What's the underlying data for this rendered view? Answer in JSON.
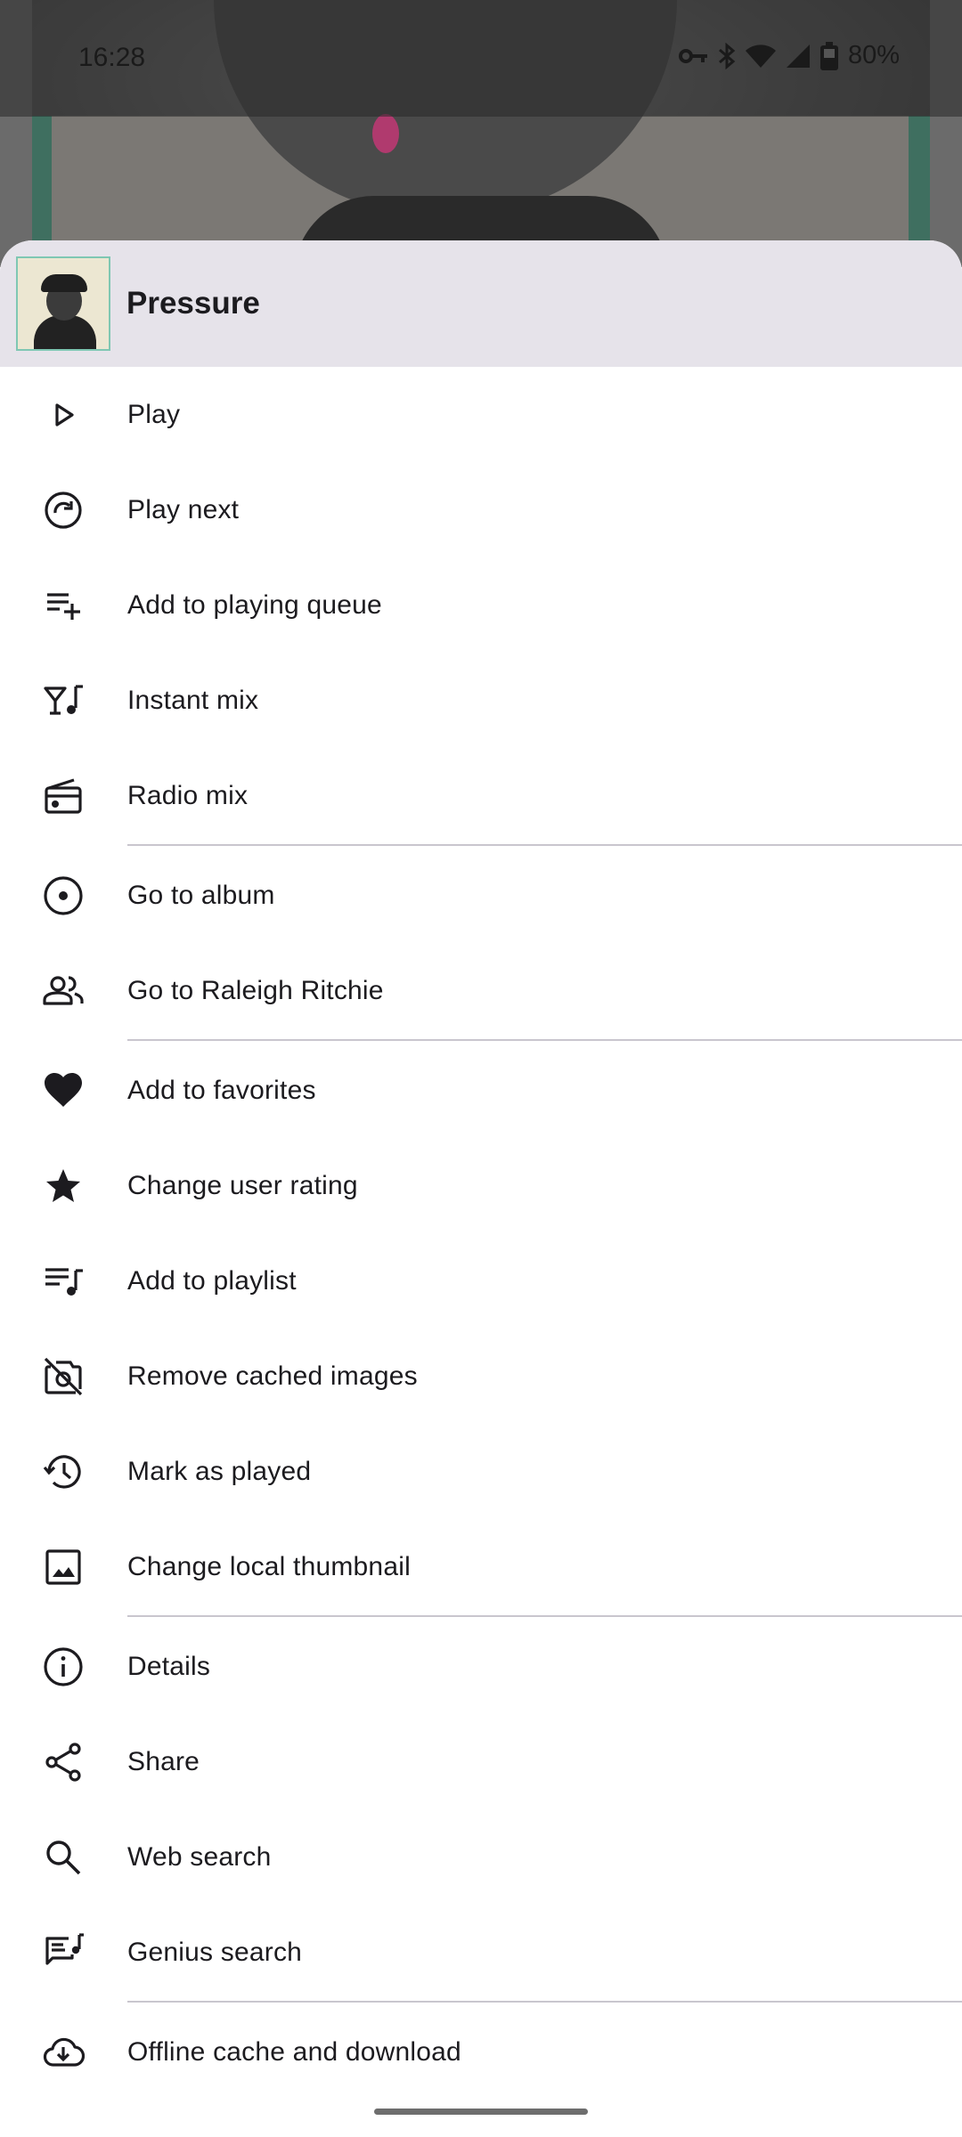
{
  "status_bar": {
    "time": "16:28",
    "battery": "80%"
  },
  "sheet": {
    "title": "Pressure",
    "menu": [
      {
        "label": "Play",
        "icon": "play-icon"
      },
      {
        "label": "Play next",
        "icon": "play-next-icon"
      },
      {
        "label": "Add to playing queue",
        "icon": "queue-add-icon"
      },
      {
        "label": "Instant mix",
        "icon": "instant-mix-icon"
      },
      {
        "label": "Radio mix",
        "icon": "radio-icon"
      },
      {
        "label": "Go to album",
        "icon": "album-icon"
      },
      {
        "label": "Go to Raleigh Ritchie",
        "icon": "artist-icon"
      },
      {
        "label": "Add to favorites",
        "icon": "heart-icon"
      },
      {
        "label": "Change user rating",
        "icon": "star-icon"
      },
      {
        "label": "Add to playlist",
        "icon": "playlist-add-icon"
      },
      {
        "label": "Remove cached images",
        "icon": "no-image-icon"
      },
      {
        "label": "Mark as played",
        "icon": "history-icon"
      },
      {
        "label": "Change local thumbnail",
        "icon": "image-icon"
      },
      {
        "label": "Details",
        "icon": "info-icon"
      },
      {
        "label": "Share",
        "icon": "share-icon"
      },
      {
        "label": "Web search",
        "icon": "search-icon"
      },
      {
        "label": "Genius search",
        "icon": "lyrics-icon"
      },
      {
        "label": "Offline cache and download",
        "icon": "cloud-download-icon"
      }
    ]
  }
}
